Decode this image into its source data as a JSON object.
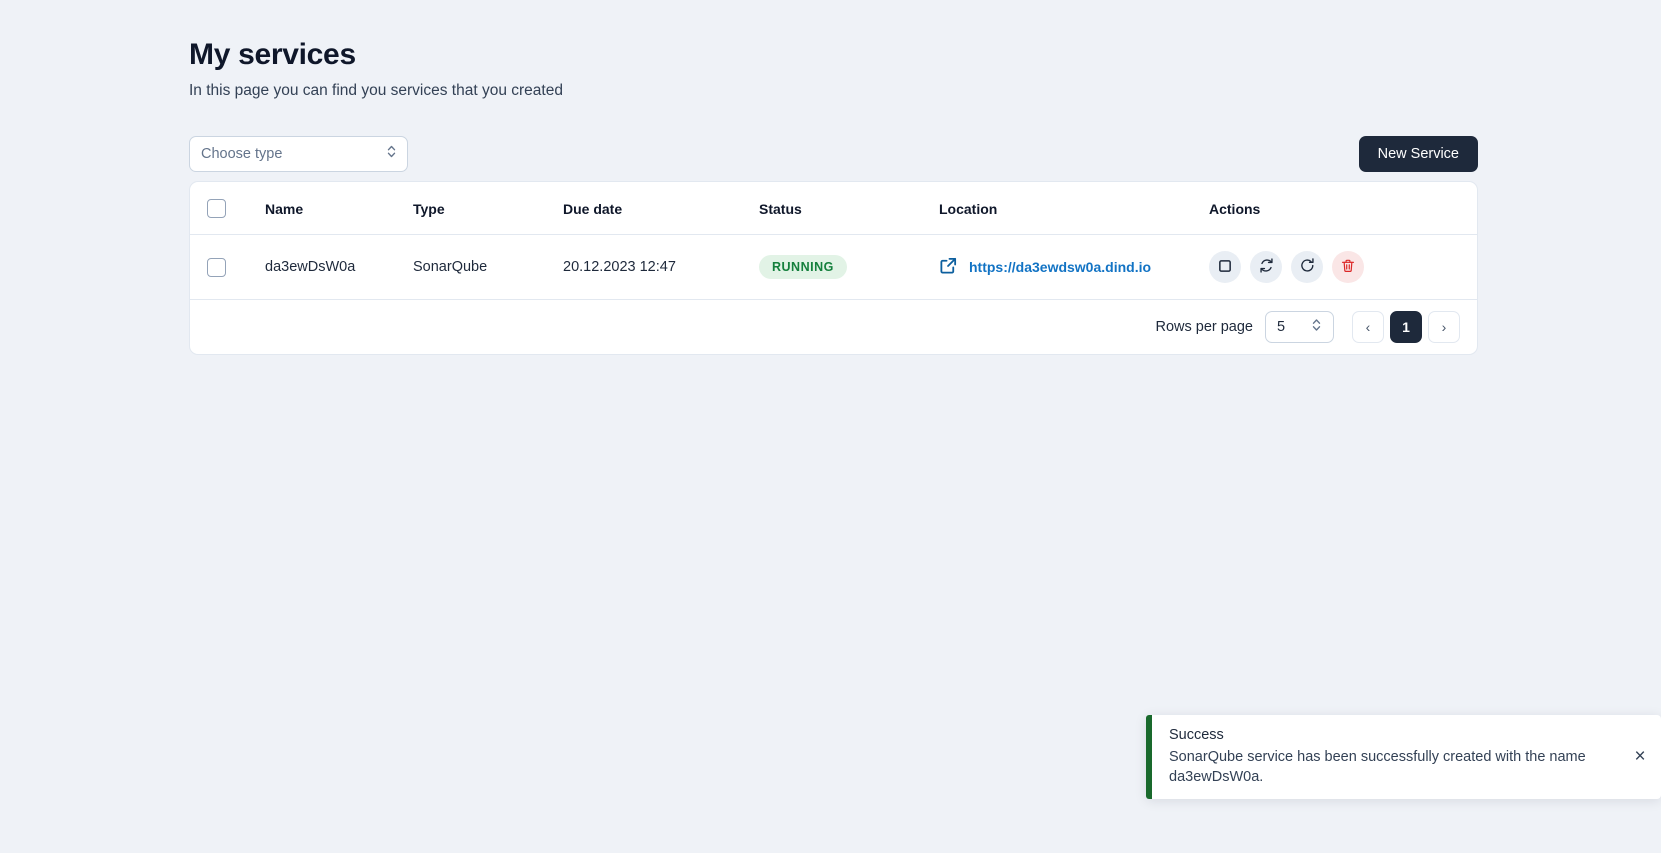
{
  "header": {
    "title": "My services",
    "subtitle": "In this page you can find you services that you created"
  },
  "toolbar": {
    "type_filter_placeholder": "Choose type",
    "new_service_label": "New Service"
  },
  "table": {
    "columns": [
      "Name",
      "Type",
      "Due date",
      "Status",
      "Location",
      "Actions"
    ],
    "rows": [
      {
        "name": "da3ewDsW0a",
        "type": "SonarQube",
        "due_date": "20.12.2023 12:47",
        "status": "RUNNING",
        "location": "https://da3ewdsw0a.dind.io",
        "actions": [
          "stop-icon",
          "restart-icon",
          "logs-icon",
          "delete-icon"
        ]
      }
    ]
  },
  "pagination": {
    "rows_per_page_label": "Rows per page",
    "rows_per_page_value": "5",
    "prev_label": "‹",
    "current_page": "1",
    "next_label": "›"
  },
  "toast": {
    "title": "Success",
    "message": "SonarQube service has been successfully created with the name da3ewDsW0a.",
    "close_label": "×"
  },
  "colors": {
    "accent_dark": "#1e293b",
    "status_running_text": "#15803d",
    "status_running_bg": "#e2f3e6",
    "link": "#1273c4",
    "toast_bar": "#19692c",
    "danger": "#dc2626",
    "page_bg": "#eff2f7"
  }
}
